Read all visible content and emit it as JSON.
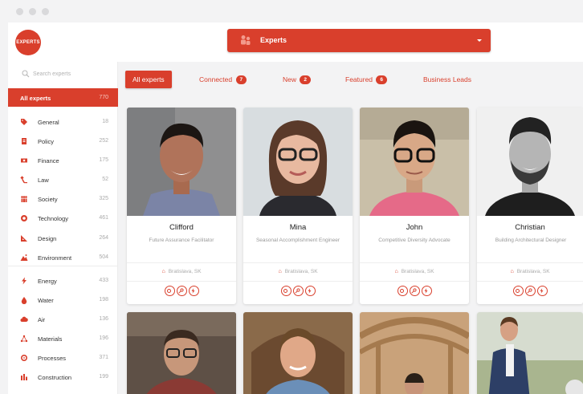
{
  "header": {
    "logo_text": "EXPERTS",
    "selector": {
      "label": "Experts",
      "icon": "experts-icon"
    }
  },
  "sidebar": {
    "search_placeholder": "Search experts",
    "active": {
      "label": "All experts",
      "count": "770"
    },
    "categories": [
      {
        "label": "General",
        "count": "18",
        "icon": "tag-icon"
      },
      {
        "label": "Policy",
        "count": "252",
        "icon": "policy-icon"
      },
      {
        "label": "Finance",
        "count": "175",
        "icon": "finance-icon"
      },
      {
        "label": "Law",
        "count": "52",
        "icon": "law-icon"
      },
      {
        "label": "Society",
        "count": "325",
        "icon": "society-icon"
      },
      {
        "label": "Technology",
        "count": "461",
        "icon": "technology-icon"
      },
      {
        "label": "Design",
        "count": "264",
        "icon": "design-icon"
      },
      {
        "label": "Environment",
        "count": "504",
        "icon": "environment-icon"
      },
      {
        "label": "Energy",
        "count": "433",
        "icon": "energy-icon"
      },
      {
        "label": "Water",
        "count": "198",
        "icon": "water-icon"
      },
      {
        "label": "Air",
        "count": "136",
        "icon": "air-icon"
      },
      {
        "label": "Materials",
        "count": "196",
        "icon": "materials-icon"
      },
      {
        "label": "Processes",
        "count": "371",
        "icon": "processes-icon"
      },
      {
        "label": "Construction",
        "count": "199",
        "icon": "construction-icon"
      }
    ]
  },
  "tabs": {
    "all": "All experts",
    "connected": {
      "label": "Connected",
      "count": "7"
    },
    "new": {
      "label": "New",
      "count": "2"
    },
    "featured": {
      "label": "Featured",
      "count": "6"
    },
    "leads": "Business Leads"
  },
  "experts": [
    {
      "name": "Clifford",
      "role": "Future Assurance Facilitator",
      "location": "Bratislava, SK"
    },
    {
      "name": "Mina",
      "role": "Seasonal Accomplishment Engineer",
      "location": "Bratislava, SK"
    },
    {
      "name": "John",
      "role": "Competitive Diversity Advocate",
      "location": "Bratislava, SK"
    },
    {
      "name": "Christian",
      "role": "Building Architectural Designer",
      "location": "Bratislava, SK"
    }
  ],
  "colors": {
    "accent": "#d93f2c",
    "sidebar_bg": "#ffffff",
    "page_bg": "#f3f3f4"
  }
}
